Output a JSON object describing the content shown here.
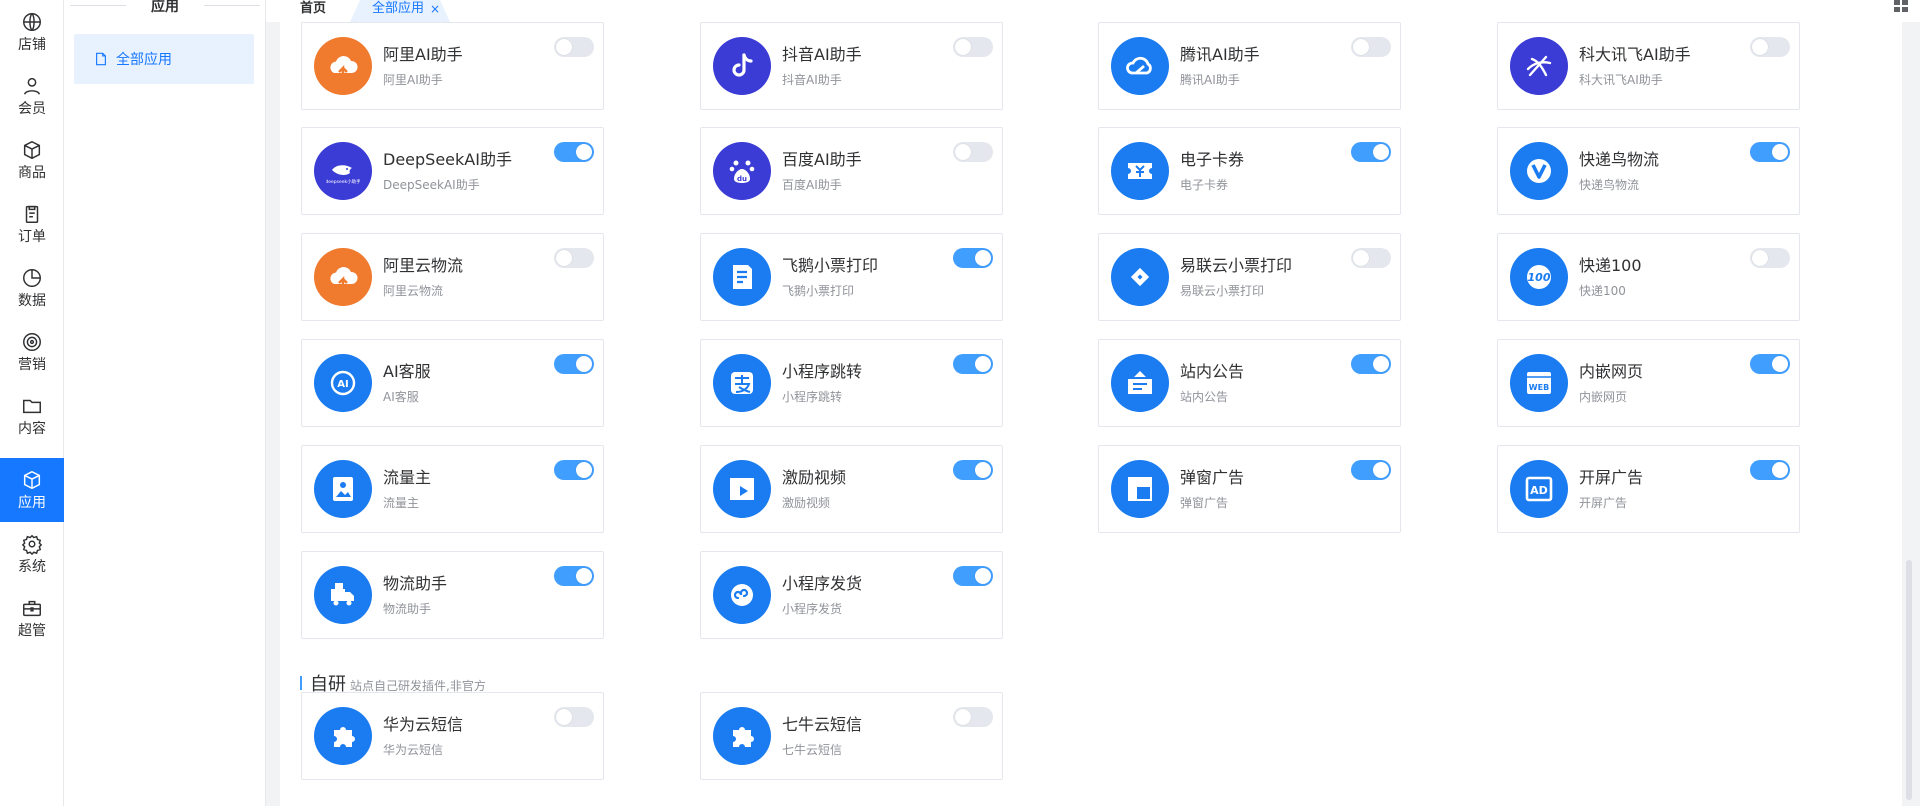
{
  "rail": [
    {
      "label": "店铺",
      "icon": "globe-icon"
    },
    {
      "label": "会员",
      "icon": "user-icon"
    },
    {
      "label": "商品",
      "icon": "box-icon"
    },
    {
      "label": "订单",
      "icon": "clipboard-icon"
    },
    {
      "label": "数据",
      "icon": "pie-chart-icon"
    },
    {
      "label": "营销",
      "icon": "target-icon"
    },
    {
      "label": "内容",
      "icon": "folder-icon"
    },
    {
      "label": "应用",
      "icon": "cube-icon",
      "active": true
    },
    {
      "label": "系统",
      "icon": "gear-icon"
    },
    {
      "label": "超管",
      "icon": "toolbox-icon"
    }
  ],
  "submenu": {
    "title": "应用",
    "item": "全部应用"
  },
  "tabs": {
    "home": "首页",
    "current": "全部应用",
    "close": "×"
  },
  "colors": {
    "primary": "#1677ff",
    "toggle_on": "#409eff",
    "toggle_off": "#e4e7ed",
    "orange": "#f07a2e",
    "indigo": "#3b3bd6",
    "blue": "#1a7cf0"
  },
  "apps": [
    {
      "name": "阿里AI助手",
      "desc": "阿里AI助手",
      "on": false,
      "icon": "aliyun-cloud-icon",
      "color": "#f07a2e"
    },
    {
      "name": "抖音AI助手",
      "desc": "抖音AI助手",
      "on": false,
      "icon": "douyin-icon",
      "color": "#3b3bd6"
    },
    {
      "name": "腾讯AI助手",
      "desc": "腾讯AI助手",
      "on": false,
      "icon": "tencent-cloud-icon",
      "color": "#1a7cf0"
    },
    {
      "name": "科大讯飞AI助手",
      "desc": "科大讯飞AI助手",
      "on": false,
      "icon": "iflytek-icon",
      "color": "#3b3bd6"
    },
    {
      "name": "DeepSeekAI助手",
      "desc": "DeepSeekAI助手",
      "on": true,
      "icon": "deepseek-whale-icon",
      "color": "#3b3bd6"
    },
    {
      "name": "百度AI助手",
      "desc": "百度AI助手",
      "on": false,
      "icon": "baidu-paw-icon",
      "color": "#3b3bd6"
    },
    {
      "name": "电子卡券",
      "desc": "电子卡券",
      "on": true,
      "icon": "coupon-icon",
      "color": "#1a7cf0"
    },
    {
      "name": "快递鸟物流",
      "desc": "快递鸟物流",
      "on": true,
      "icon": "kdniao-icon",
      "color": "#1a7cf0"
    },
    {
      "name": "阿里云物流",
      "desc": "阿里云物流",
      "on": false,
      "icon": "aliyun-cloud-icon",
      "color": "#f07a2e"
    },
    {
      "name": "飞鹅小票打印",
      "desc": "飞鹅小票打印",
      "on": true,
      "icon": "receipt-icon",
      "color": "#1a7cf0"
    },
    {
      "name": "易联云小票打印",
      "desc": "易联云小票打印",
      "on": false,
      "icon": "link-icon",
      "color": "#1a7cf0"
    },
    {
      "name": "快递100",
      "desc": "快递100",
      "on": false,
      "icon": "kuaidi100-icon",
      "color": "#1a7cf0"
    },
    {
      "name": "AI客服",
      "desc": "AI客服",
      "on": true,
      "icon": "ai-service-icon",
      "color": "#1a7cf0"
    },
    {
      "name": "小程序跳转",
      "desc": "小程序跳转",
      "on": true,
      "icon": "alipay-icon",
      "color": "#1a7cf0"
    },
    {
      "name": "站内公告",
      "desc": "站内公告",
      "on": true,
      "icon": "notice-icon",
      "color": "#1a7cf0"
    },
    {
      "name": "内嵌网页",
      "desc": "内嵌网页",
      "on": true,
      "icon": "web-icon",
      "color": "#1a7cf0"
    },
    {
      "name": "流量主",
      "desc": "流量主",
      "on": true,
      "icon": "image-ad-icon",
      "color": "#1a7cf0"
    },
    {
      "name": "激励视频",
      "desc": "激励视频",
      "on": true,
      "icon": "video-icon",
      "color": "#1a7cf0"
    },
    {
      "name": "弹窗广告",
      "desc": "弹窗广告",
      "on": true,
      "icon": "popup-icon",
      "color": "#1a7cf0"
    },
    {
      "name": "开屏广告",
      "desc": "开屏广告",
      "on": true,
      "icon": "ad-icon",
      "color": "#1a7cf0"
    },
    {
      "name": "物流助手",
      "desc": "物流助手",
      "on": true,
      "icon": "truck-icon",
      "color": "#1a7cf0"
    },
    {
      "name": "小程序发货",
      "desc": "小程序发货",
      "on": true,
      "icon": "miniprogram-icon",
      "color": "#1a7cf0"
    }
  ],
  "section": {
    "title": "自研",
    "subtitle": "站点自己研发插件,非官方"
  },
  "self_apps": [
    {
      "name": "华为云短信",
      "desc": "华为云短信",
      "on": false,
      "icon": "puzzle-icon",
      "color": "#1a7cf0"
    },
    {
      "name": "七牛云短信",
      "desc": "七牛云短信",
      "on": false,
      "icon": "puzzle-icon",
      "color": "#1a7cf0"
    }
  ]
}
